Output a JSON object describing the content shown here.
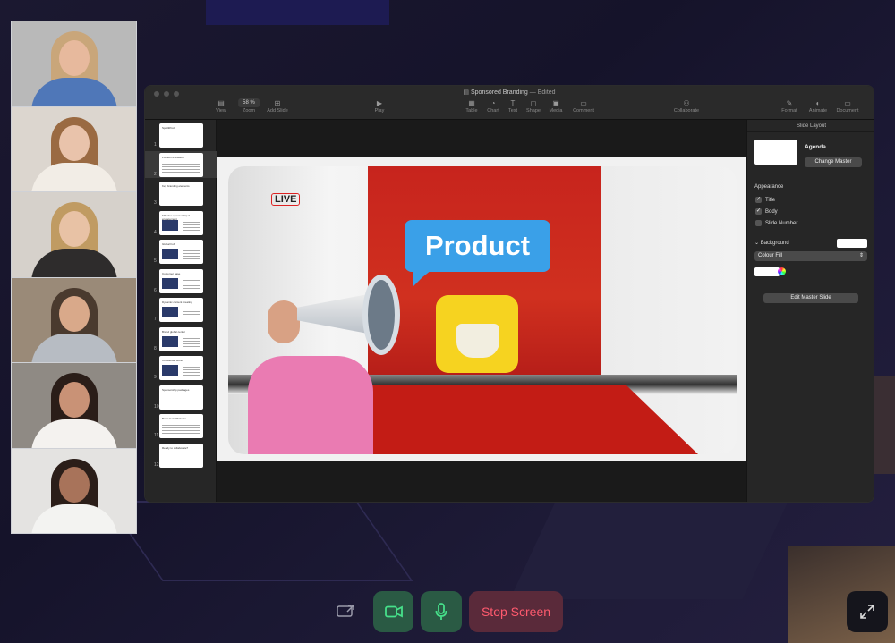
{
  "window": {
    "doc_title": "Sponsored Branding",
    "doc_status": "— Edited",
    "zoom": "58 %"
  },
  "toolbar": [
    {
      "id": "view",
      "label": "View",
      "icon": "sidebar-icon",
      "glyph": "▤"
    },
    {
      "id": "zoom",
      "label": "Zoom",
      "icon": "zoom-icon",
      "glyph": ""
    },
    {
      "id": "add-slide",
      "label": "Add Slide",
      "icon": "add-slide-icon",
      "glyph": "⊞"
    },
    {
      "id": "play",
      "label": "Play",
      "icon": "play-icon",
      "glyph": "▶"
    },
    {
      "id": "table",
      "label": "Table",
      "icon": "table-icon",
      "glyph": "▦"
    },
    {
      "id": "chart",
      "label": "Chart",
      "icon": "chart-icon",
      "glyph": "◔"
    },
    {
      "id": "text",
      "label": "Text",
      "icon": "text-icon",
      "glyph": "T"
    },
    {
      "id": "shape",
      "label": "Shape",
      "icon": "shape-icon",
      "glyph": "◻"
    },
    {
      "id": "media",
      "label": "Media",
      "icon": "media-icon",
      "glyph": "▣"
    },
    {
      "id": "comment",
      "label": "Comment",
      "icon": "comment-icon",
      "glyph": "▭"
    },
    {
      "id": "collaborate",
      "label": "Collaborate",
      "icon": "collaborate-icon",
      "glyph": "⚇"
    },
    {
      "id": "format",
      "label": "Format",
      "icon": "format-brush-icon",
      "glyph": "✎"
    },
    {
      "id": "animate",
      "label": "Animate",
      "icon": "animate-icon",
      "glyph": "◐"
    },
    {
      "id": "document",
      "label": "Document",
      "icon": "document-icon",
      "glyph": "▭"
    }
  ],
  "slides": [
    {
      "num": "1",
      "title": "SpotlitPod",
      "kind": "title"
    },
    {
      "num": "2",
      "title": "Position & Mission",
      "kind": "text",
      "selected": true
    },
    {
      "num": "3",
      "title": "Key branding elements",
      "kind": "title"
    },
    {
      "num": "4",
      "title": "Effective sponsorship & engagement",
      "kind": "image"
    },
    {
      "num": "5",
      "title": "Global hub",
      "kind": "image"
    },
    {
      "num": "6",
      "title": "Customer base",
      "kind": "image"
    },
    {
      "num": "7",
      "title": "Dynamic content creating",
      "kind": "image"
    },
    {
      "num": "8",
      "title": "Brand global center",
      "kind": "image"
    },
    {
      "num": "9",
      "title": "Collaborate works",
      "kind": "image"
    },
    {
      "num": "10",
      "title": "Sponsorship packages",
      "kind": "title"
    },
    {
      "num": "11",
      "title": "Basic  Gold  Platinum",
      "kind": "text"
    },
    {
      "num": "12",
      "title": "Ready to collaborate?",
      "kind": "title"
    }
  ],
  "slide": {
    "bubble_text": "Product",
    "live_badge": "LIVE"
  },
  "inspector": {
    "panel_title": "Slide Layout",
    "master_name": "Agenda",
    "change_master": "Change Master",
    "appearance_label": "Appearance",
    "checkboxes": [
      {
        "label": "Title",
        "checked": true
      },
      {
        "label": "Body",
        "checked": true
      },
      {
        "label": "Slide Number",
        "checked": false
      }
    ],
    "background_label": "Background",
    "fill_type": "Colour Fill",
    "edit_master": "Edit Master Slide"
  },
  "participants": [
    {
      "name": "participant-1",
      "skin": "#e7b99d",
      "hair": "#c9a67a",
      "shirt": "#4f77b8",
      "bg": "#b9b9b9"
    },
    {
      "name": "participant-2",
      "skin": "#e9c3ab",
      "hair": "#9a6a42",
      "shirt": "#f2ede6",
      "bg": "#dcd6cf"
    },
    {
      "name": "participant-3",
      "skin": "#e8c2a5",
      "hair": "#c09b62",
      "shirt": "#2e2c2c",
      "bg": "#d6d1cb"
    },
    {
      "name": "participant-4",
      "skin": "#d9a98a",
      "hair": "#4a3a2e",
      "shirt": "#b7bcc3",
      "bg": "#9a8a78"
    },
    {
      "name": "participant-5",
      "skin": "#c99276",
      "hair": "#2a1d18",
      "shirt": "#f4f2ef",
      "bg": "#8f8a84"
    },
    {
      "name": "participant-6",
      "skin": "#a8735a",
      "hair": "#2b1e19",
      "shirt": "#f3f3f1",
      "bg": "#e4e3e1"
    }
  ],
  "controls": {
    "share_icon": "screen-share-icon",
    "camera_icon": "camera-icon",
    "mic_icon": "microphone-icon",
    "stop_label": "Stop Screen",
    "fullscreen_icon": "expand-icon",
    "green_bg": "#2a5a44",
    "green_fg": "#46e08a",
    "red_bg": "#5a2a3a",
    "red_fg": "#ff5a6e"
  }
}
